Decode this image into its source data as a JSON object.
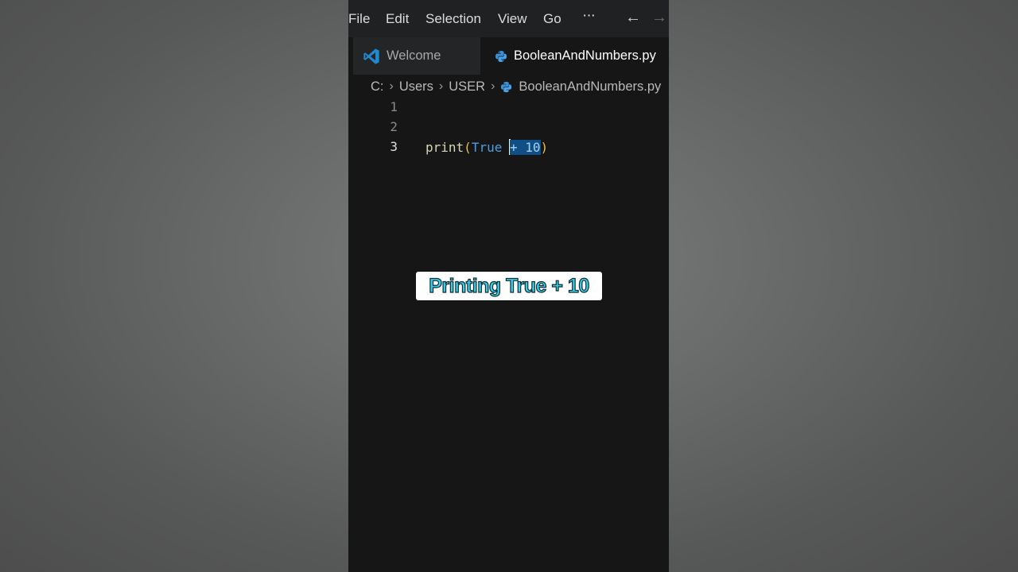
{
  "menu": {
    "items": [
      "File",
      "Edit",
      "Selection",
      "View",
      "Go",
      "···"
    ],
    "back_icon": "←",
    "forward_icon": "→"
  },
  "tabs": [
    {
      "label": "Welcome",
      "icon": "vscode-logo-icon",
      "active": false
    },
    {
      "label": "BooleanAndNumbers.py",
      "icon": "python-icon",
      "active": true
    }
  ],
  "breadcrumb": {
    "parts": [
      "C:",
      "Users",
      "USER",
      "BooleanAndNumbers.py"
    ]
  },
  "editor": {
    "lines": [
      {
        "number": "1",
        "active": false
      },
      {
        "number": "2",
        "active": false
      },
      {
        "number": "3",
        "active": true
      }
    ],
    "code": {
      "fn": "print",
      "open": "(",
      "kw": "True",
      "space": " ",
      "selected": "+ 10",
      "close": ")"
    }
  },
  "caption": {
    "text": "Printing True + 10"
  },
  "colors": {
    "editor_bg": "#161617",
    "selection": "#0f4f86",
    "keyword": "#4a9ee0",
    "caption_text": "#3ad0e8"
  }
}
